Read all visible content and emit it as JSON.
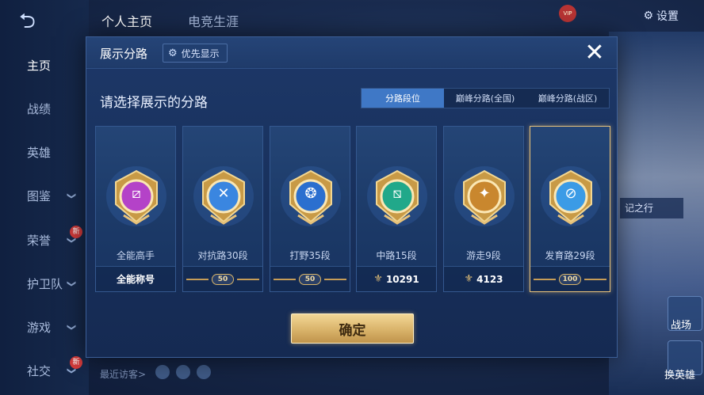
{
  "background": {
    "nav_items": [
      {
        "label": "主页",
        "chevron": false,
        "badge": "",
        "active": true
      },
      {
        "label": "战绩",
        "chevron": false,
        "badge": ""
      },
      {
        "label": "英雄",
        "chevron": false,
        "badge": ""
      },
      {
        "label": "图鉴",
        "chevron": true,
        "badge": ""
      },
      {
        "label": "荣誉",
        "chevron": true,
        "badge": "新"
      },
      {
        "label": "护卫队",
        "chevron": true,
        "badge": ""
      },
      {
        "label": "游戏",
        "chevron": true,
        "badge": ""
      },
      {
        "label": "社交",
        "chevron": true,
        "badge": "新"
      }
    ],
    "top_tabs": [
      "个人主页",
      "电竞生涯"
    ],
    "settings_label": "设置",
    "vip_label": "VIP",
    "side_chip_label": "记之行",
    "recent_visitors_label": "最近访客>",
    "mini_labels": [
      "战场",
      "换英雄"
    ]
  },
  "modal": {
    "title": "展示分路",
    "priority_button_label": "优先显示",
    "close_label": "✕",
    "subtitle": "请选择展示的分路",
    "tabs": [
      {
        "label": "分路段位",
        "selected": true
      },
      {
        "label": "巅峰分路(全国)",
        "selected": false
      },
      {
        "label": "巅峰分路(战区)",
        "selected": false
      }
    ],
    "cards": [
      {
        "label": "全能高手",
        "footer_type": "text",
        "footer": "全能称号",
        "emblem_color": "#b442c8",
        "selected": false
      },
      {
        "label": "对抗路30段",
        "footer_type": "level",
        "footer": "50",
        "emblem_color": "#3a86e0",
        "selected": false
      },
      {
        "label": "打野35段",
        "footer_type": "level",
        "footer": "50",
        "emblem_color": "#2b6fcf",
        "selected": false
      },
      {
        "label": "中路15段",
        "footer_type": "points",
        "footer": "10291",
        "emblem_color": "#21a88a",
        "selected": false
      },
      {
        "label": "游走9段",
        "footer_type": "points",
        "footer": "4123",
        "emblem_color": "#c9872e",
        "selected": false
      },
      {
        "label": "发育路29段",
        "footer_type": "level",
        "footer": "100",
        "emblem_color": "#3b9be6",
        "selected": true
      }
    ],
    "confirm_label": "确定"
  },
  "colors": {
    "accent_gold": "#e7c27a",
    "tab_selected": "#3f78c6",
    "panel": "#1d3868"
  }
}
